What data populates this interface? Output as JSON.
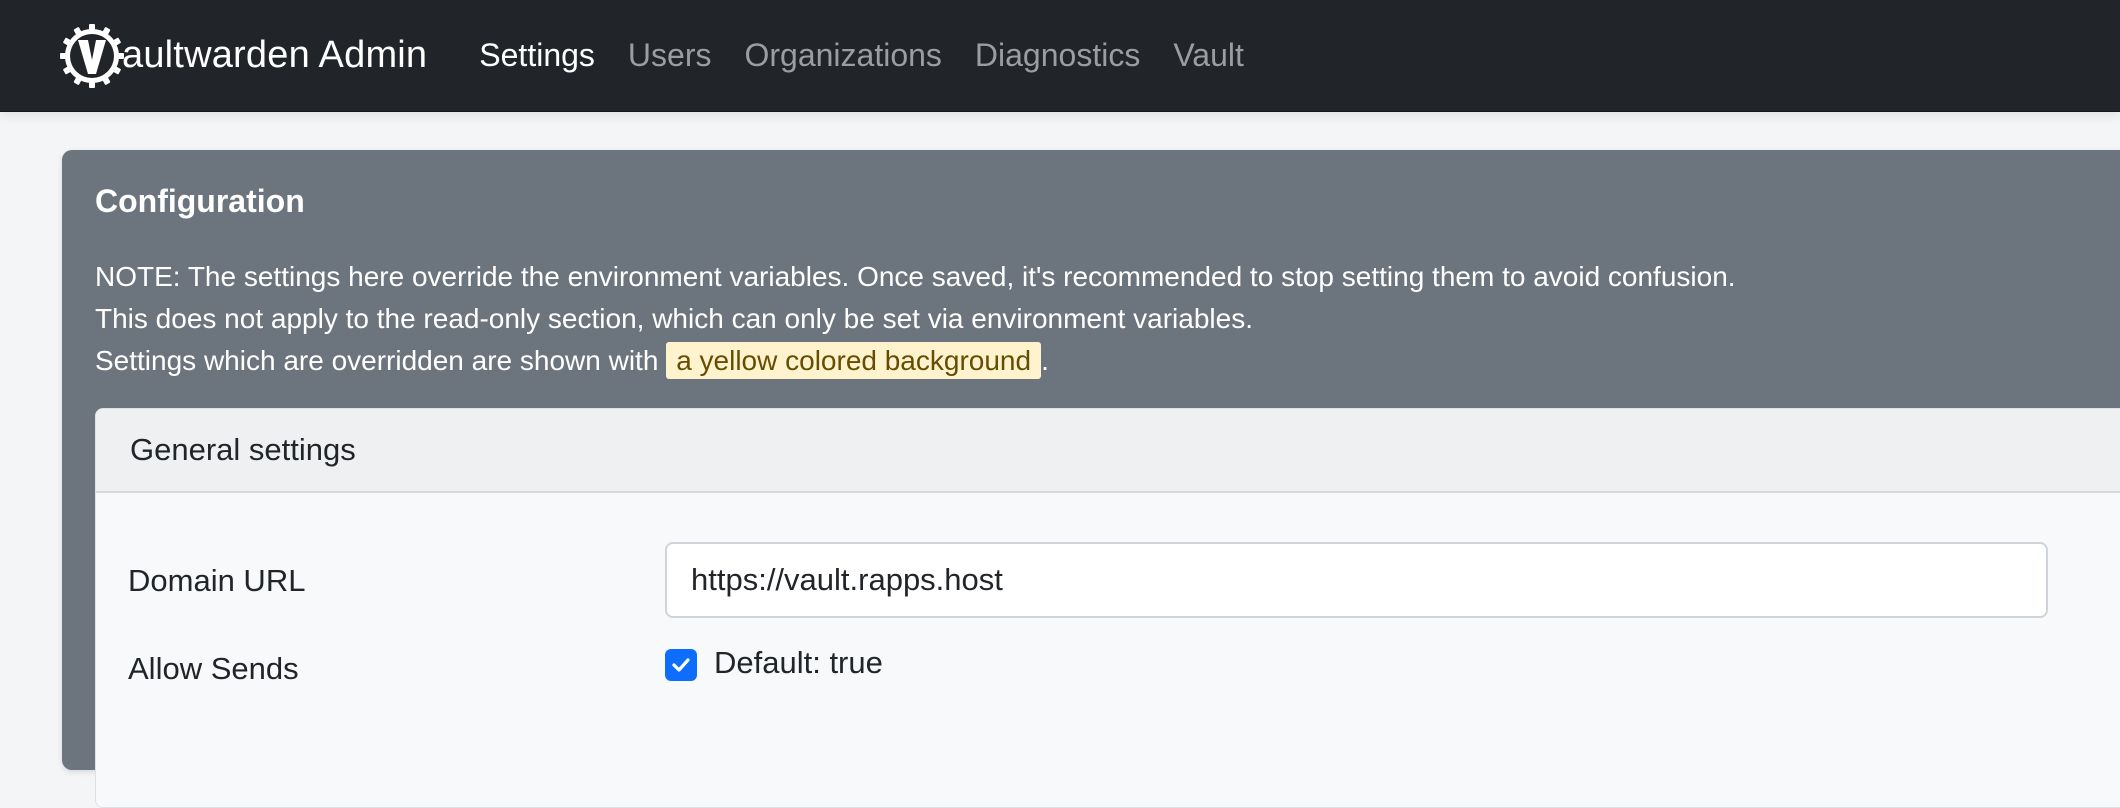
{
  "navbar": {
    "brand": "aultwarden Admin",
    "links": [
      "Settings",
      "Users",
      "Organizations",
      "Diagnostics",
      "Vault"
    ],
    "active": "Settings"
  },
  "config": {
    "title": "Configuration",
    "note_line1": "NOTE: The settings here override the environment variables. Once saved, it's recommended to stop setting them to avoid confusion.",
    "note_line2": "This does not apply to the read-only section, which can only be set via environment variables.",
    "note_line3_prefix": "Settings which are overridden are shown with",
    "note_highlight": "a yellow colored background",
    "note_line3_suffix": "."
  },
  "general": {
    "header": "General settings",
    "domain_label": "Domain URL",
    "domain_value": "https://vault.rapps.host",
    "sends_label": "Allow Sends",
    "sends_checked": true,
    "sends_default": "Default: true"
  },
  "colors": {
    "navbar_bg": "#212529",
    "card_bg": "#6c757d",
    "highlight_bg": "#fff3cd",
    "checkbox": "#0d6efd"
  },
  "icons": [
    "vaultwarden-logo-icon",
    "check-icon"
  ]
}
